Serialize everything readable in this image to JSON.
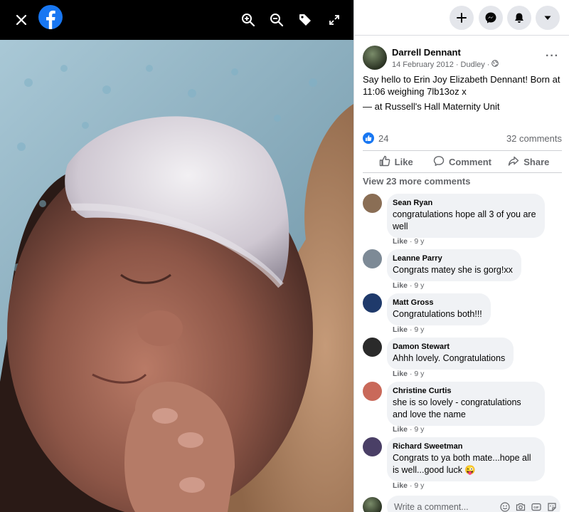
{
  "viewer": {
    "icons": [
      "close-icon",
      "facebook-logo",
      "zoom-in-icon",
      "zoom-out-icon",
      "tag-icon",
      "fullscreen-icon"
    ]
  },
  "topbar": {
    "icons": [
      "plus-icon",
      "messenger-icon",
      "bell-icon",
      "caret-down-icon"
    ]
  },
  "post": {
    "author": "Darrell Dennant",
    "date": "14 February 2012",
    "separator": "·",
    "location": "Dudley",
    "separator2": "·",
    "text": "Say hello to Erin Joy Elizabeth Dennant! Born at 11:06 weighing 7lb13oz x",
    "checkin_prefix": "— at",
    "checkin_place": "Russell's Hall Maternity Unit",
    "like_count": "24",
    "comment_count": "32 comments",
    "more": "···"
  },
  "actions": {
    "like": "Like",
    "comment": "Comment",
    "share": "Share"
  },
  "comments_section": {
    "view_more": "View 23 more comments",
    "items": [
      {
        "name": "Sean Ryan",
        "text": "congratulations hope all 3 of you are well",
        "like": "Like",
        "sep": "·",
        "time": "9 y",
        "avatar_color": "#8a6e55"
      },
      {
        "name": "Leanne Parry",
        "text": "Congrats matey she is gorg!xx",
        "like": "Like",
        "sep": "·",
        "time": "9 y",
        "avatar_color": "#7d8a96"
      },
      {
        "name": "Matt Gross",
        "text": "Congratulations both!!!",
        "like": "Like",
        "sep": "·",
        "time": "9 y",
        "avatar_color": "#1f3a6b"
      },
      {
        "name": "Damon Stewart",
        "text": "Ahhh lovely. Congratulations",
        "like": "Like",
        "sep": "·",
        "time": "9 y",
        "avatar_color": "#2a2a2a"
      },
      {
        "name": "Christine Curtis",
        "text": "she is so lovely - congratulations and love the name",
        "like": "Like",
        "sep": "·",
        "time": "9 y",
        "avatar_color": "#c9695a"
      },
      {
        "name": "Richard Sweetman",
        "text": "Congrats to ya both mate...hope all is well...good luck 😜",
        "like": "Like",
        "sep": "·",
        "time": "9 y",
        "avatar_color": "#4a3f66"
      }
    ]
  },
  "composer": {
    "placeholder": "Write a comment..."
  },
  "colors": {
    "brand": "#1877f2",
    "muted": "#65676b",
    "bubble": "#f0f2f5"
  }
}
